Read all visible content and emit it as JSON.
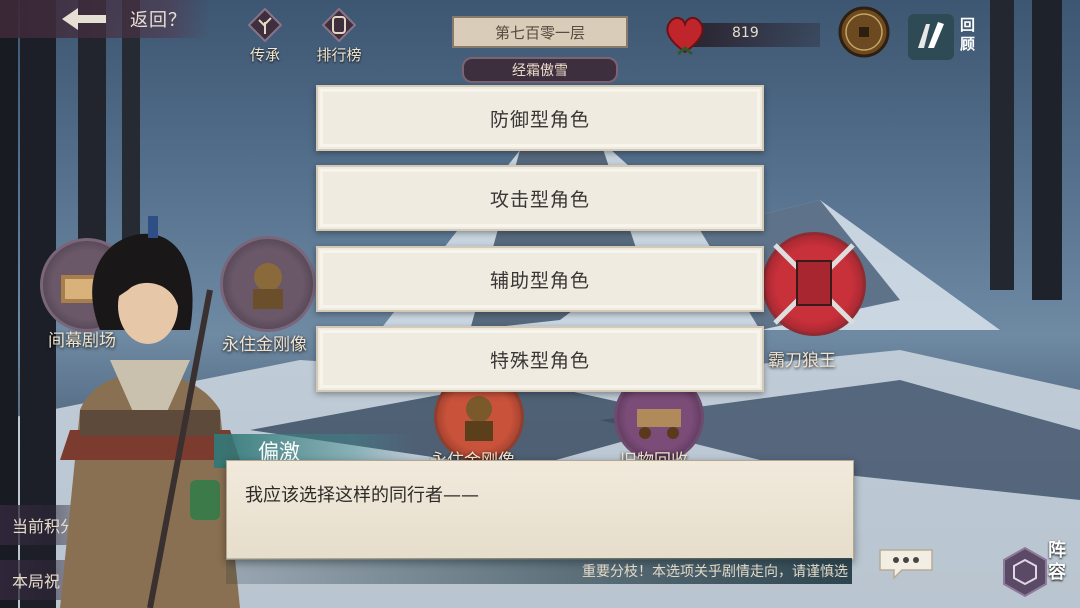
{
  "topbar": {
    "back_label": "返回？",
    "nav": [
      {
        "label": "传承",
        "icon": "tree-icon"
      },
      {
        "label": "排行榜",
        "icon": "ranking-icon"
      }
    ],
    "floor_title": "第七百零一层",
    "stage_name": "经霜傲雪",
    "hp_value": "819",
    "review_label": "回顾"
  },
  "map": {
    "node_labels": [
      "间幕剧场",
      "永住金刚像",
      "霸刀狼王",
      "永住金刚像",
      "旧物回收"
    ]
  },
  "choices": [
    {
      "label": "防御型角色"
    },
    {
      "label": "攻击型角色"
    },
    {
      "label": "辅助型角色"
    },
    {
      "label": "特殊型角色"
    }
  ],
  "side": {
    "score_label": "当前积分",
    "blessing_label": "本局祝"
  },
  "dialog": {
    "speaker": "偏激",
    "text": "我应该选择这样的同行者——",
    "warning": "重要分枝！本选项关乎剧情走向，请谨慎选"
  },
  "buttons": {
    "lineup_label": "阵容"
  },
  "colors": {
    "choice_bg": "#efebe1",
    "name_tag": "#327878",
    "heart": "#c0252c"
  }
}
